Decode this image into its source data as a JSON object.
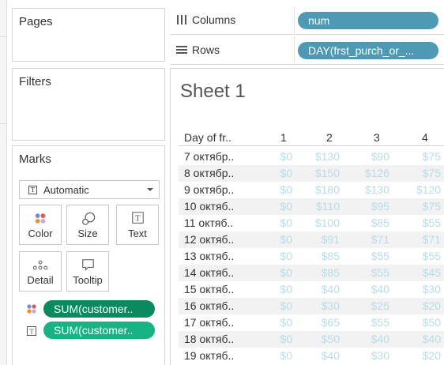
{
  "cards": {
    "pages_title": "Pages",
    "filters_title": "Filters",
    "marks_title": "Marks"
  },
  "marks": {
    "type_label": "Automatic",
    "buttons": [
      "Color",
      "Size",
      "Text",
      "Detail",
      "Tooltip"
    ],
    "fields": [
      "SUM(customer..",
      "SUM(customer.."
    ]
  },
  "shelves": {
    "columns_label": "Columns",
    "columns_pill": "num",
    "rows_label": "Rows",
    "rows_pill": "DAY(frst_purch_or_..."
  },
  "sheet": {
    "title": "Sheet 1",
    "row_header": "Day of fr..",
    "columns": [
      "1",
      "2",
      "3",
      "4"
    ],
    "rows": [
      {
        "date": "7 октябр..",
        "values": [
          "$0",
          "$130",
          "$90",
          "$75"
        ]
      },
      {
        "date": "8 октябр..",
        "values": [
          "$0",
          "$150",
          "$126",
          "$75"
        ]
      },
      {
        "date": "9 октябр..",
        "values": [
          "$0",
          "$180",
          "$130",
          "$120"
        ]
      },
      {
        "date": "10 октяб..",
        "values": [
          "$0",
          "$110",
          "$95",
          "$75"
        ]
      },
      {
        "date": "11 октяб..",
        "values": [
          "$0",
          "$100",
          "$85",
          "$55"
        ]
      },
      {
        "date": "12 октяб..",
        "values": [
          "$0",
          "$91",
          "$71",
          "$71"
        ]
      },
      {
        "date": "13 октяб..",
        "values": [
          "$0",
          "$85",
          "$55",
          "$55"
        ]
      },
      {
        "date": "14 октяб..",
        "values": [
          "$0",
          "$85",
          "$55",
          "$45"
        ]
      },
      {
        "date": "15 октяб..",
        "values": [
          "$0",
          "$40",
          "$40",
          "$30"
        ]
      },
      {
        "date": "16 октяб..",
        "values": [
          "$0",
          "$30",
          "$25",
          "$20"
        ]
      },
      {
        "date": "17 октяб..",
        "values": [
          "$0",
          "$65",
          "$55",
          "$50"
        ]
      },
      {
        "date": "18 октяб..",
        "values": [
          "$0",
          "$50",
          "$40",
          "$40"
        ]
      },
      {
        "date": "19 октяб..",
        "values": [
          "$0",
          "$40",
          "$30",
          "$20"
        ]
      }
    ]
  },
  "colors": {
    "pill_blue": "#4e9ab5",
    "pill_green_dark": "#0a8a5e",
    "pill_green_light": "#17b382",
    "value_text": "#b8dce7"
  }
}
